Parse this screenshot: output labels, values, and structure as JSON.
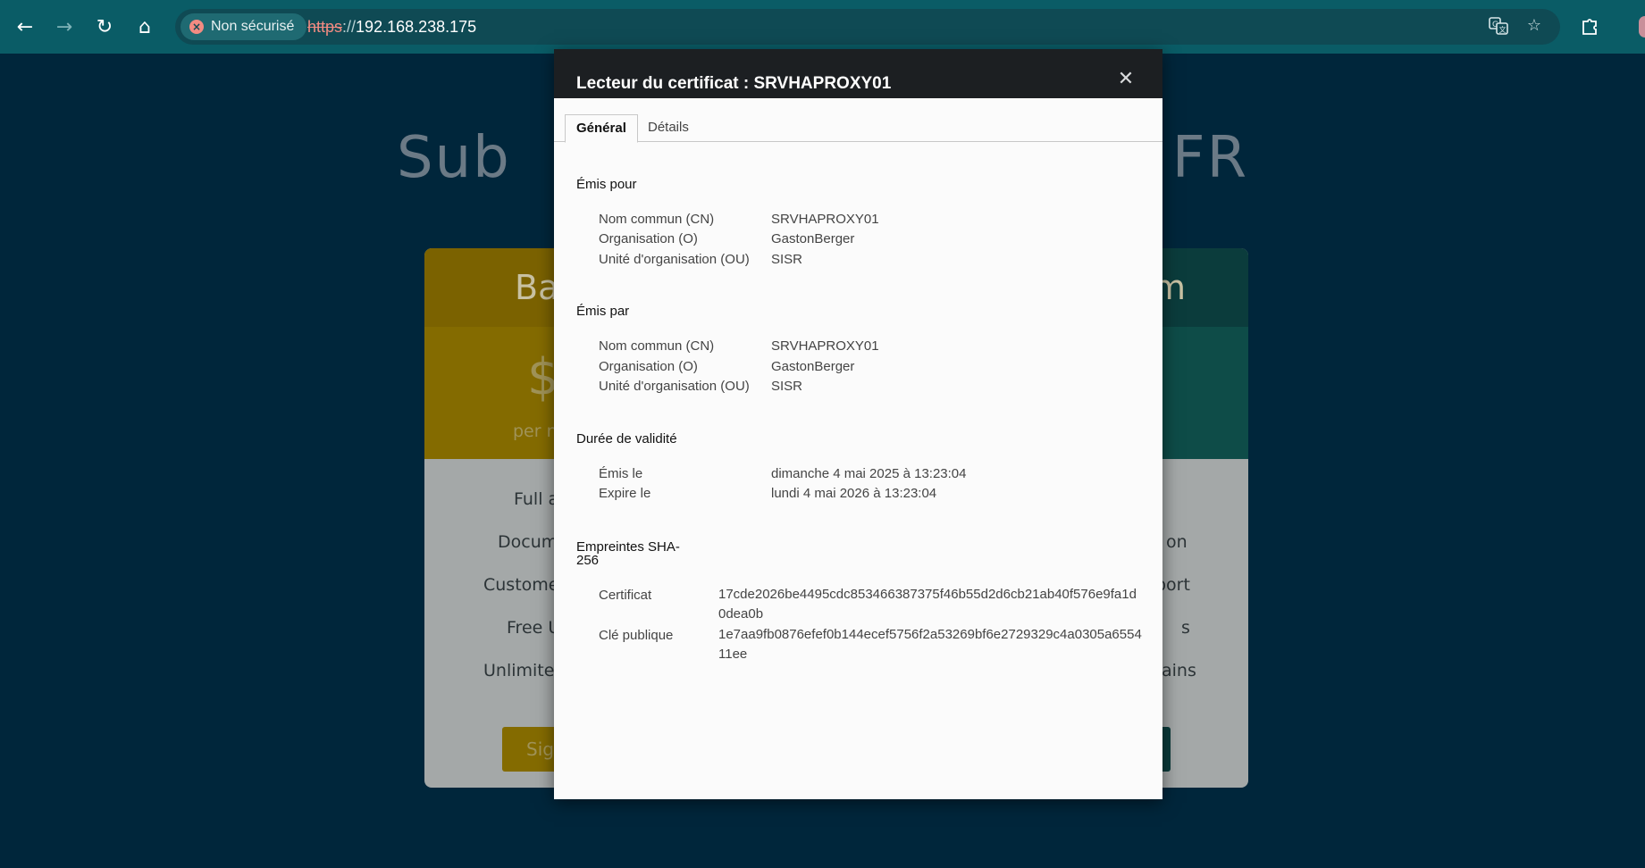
{
  "browser": {
    "security_label": "Non sécurisé",
    "url_scheme": "https",
    "url_separator": "://",
    "url_host": "192.168.238.175"
  },
  "background_page": {
    "hero_fragment_left": "Sub",
    "hero_fragment_right": "FR",
    "card_left_title": "Ba",
    "card_right_title": "m",
    "price_symbol": "$",
    "price_period": "per n",
    "features_left": [
      "Full a",
      "Docum",
      "Custome",
      "Free U",
      "Unlimite"
    ],
    "features_right": [
      "on",
      "port",
      "s",
      "ains"
    ],
    "signup_label": "Sig"
  },
  "dialog": {
    "title": "Lecteur du certificat : SRVHAPROXY01",
    "tabs": [
      {
        "label": "Général",
        "active": true
      },
      {
        "label": "Détails",
        "active": false
      }
    ],
    "issued_to": {
      "heading": "Émis pour",
      "rows": [
        {
          "label": "Nom commun (CN)",
          "value": "SRVHAPROXY01"
        },
        {
          "label": "Organisation (O)",
          "value": "GastonBerger"
        },
        {
          "label": "Unité d'organisation (OU)",
          "value": "SISR"
        }
      ]
    },
    "issued_by": {
      "heading": "Émis par",
      "rows": [
        {
          "label": "Nom commun (CN)",
          "value": "SRVHAPROXY01"
        },
        {
          "label": "Organisation (O)",
          "value": "GastonBerger"
        },
        {
          "label": "Unité d'organisation (OU)",
          "value": "SISR"
        }
      ]
    },
    "validity": {
      "heading": "Durée de validité",
      "rows": [
        {
          "label": "Émis le",
          "value": "dimanche 4 mai 2025 à 13:23:04"
        },
        {
          "label": "Expire le",
          "value": "lundi 4 mai 2026 à 13:23:04"
        }
      ]
    },
    "fingerprints": {
      "heading_line1": "Empreintes SHA-",
      "heading_line2": "256",
      "rows": [
        {
          "label": "Certificat",
          "value": "17cde2026be4495cdc853466387375f46b55d2d6cb21ab40f576e9fa1d0dea0b"
        },
        {
          "label": "Clé publique",
          "value": "1e7aa9fb0876efef0b144ecef5756f2a53269bf6e2729329c4a0305a655411ee"
        }
      ]
    }
  },
  "colors": {
    "toolbar": "#0a5c66",
    "page_bg": "#00263b",
    "dialog_header": "#1c1f22",
    "insecure_red": "#f28b82"
  },
  "icons": {
    "back": "arrow-left-icon",
    "forward": "arrow-right-icon",
    "reload": "reload-icon",
    "home": "home-icon",
    "translate": "translate-icon",
    "bookmark": "star-icon",
    "extensions": "puzzle-icon",
    "close": "close-icon"
  }
}
